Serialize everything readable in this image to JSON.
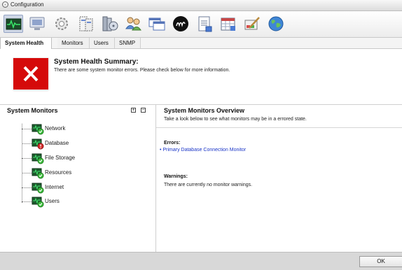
{
  "window": {
    "title": "Configuration"
  },
  "toolbar": {
    "icons": [
      "system-health-icon",
      "monitor-screen-icon",
      "gear-icon",
      "server-rack-icon",
      "storage-cylinder-icon",
      "users-group-icon",
      "windows-icon",
      "brand-logo-icon",
      "notepad-icon",
      "calendar-icon",
      "paint-brush-icon",
      "globe-icon"
    ],
    "selected_index": 0
  },
  "tabs": [
    {
      "label": "System Health",
      "active": true
    },
    {
      "label": "Monitors",
      "active": false
    },
    {
      "label": "Users",
      "active": false
    },
    {
      "label": "SNMP",
      "active": false
    }
  ],
  "summary": {
    "title": "System Health Summary:",
    "text": "There are some system monitor errors. Please check below for more information.",
    "status": "error",
    "status_color": "#d50a0a"
  },
  "monitors": {
    "title": "System Monitors",
    "expand_symbol": "+",
    "collapse_symbol": "−",
    "items": [
      {
        "label": "Network",
        "status": "ok"
      },
      {
        "label": "Database",
        "status": "error"
      },
      {
        "label": "File Storage",
        "status": "ok"
      },
      {
        "label": "Resources",
        "status": "ok"
      },
      {
        "label": "Internet",
        "status": "ok"
      },
      {
        "label": "Users",
        "status": "ok"
      }
    ]
  },
  "overview": {
    "title": "System Monitors Overview",
    "subtitle": "Take a look below to see what monitors may be in a errored state.",
    "errors_heading": "Errors:",
    "errors": [
      "Primary Database Connection Monitor"
    ],
    "warnings_heading": "Warnings:",
    "warnings_text": "There are currently no monitor warnings."
  },
  "footer": {
    "ok_label": "OK"
  }
}
